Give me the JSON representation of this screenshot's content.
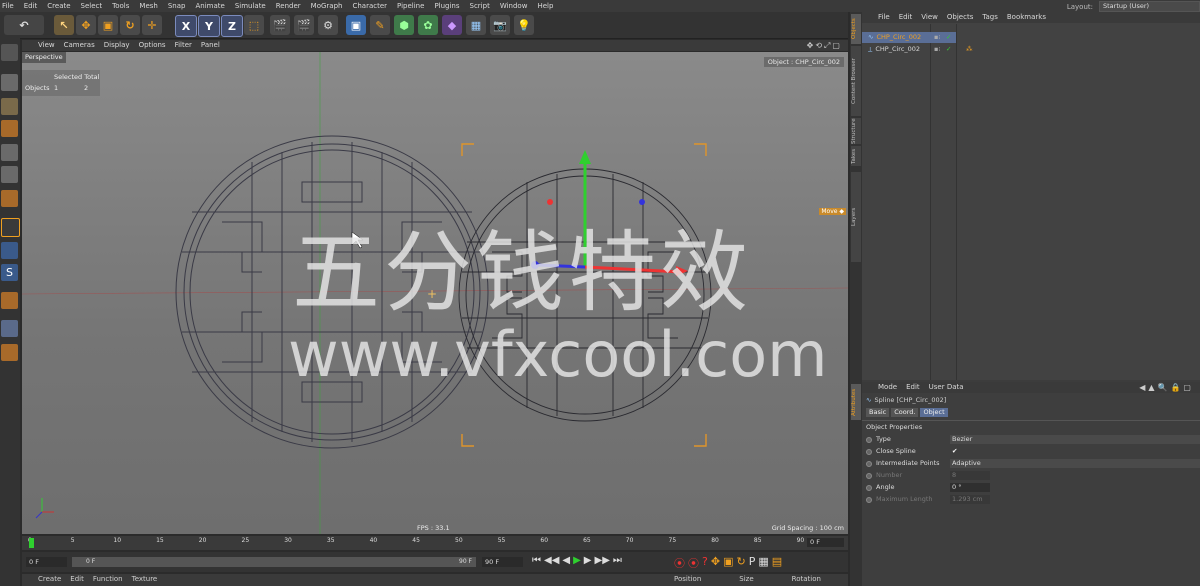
{
  "menubar": {
    "items": [
      "File",
      "Edit",
      "Create",
      "Select",
      "Tools",
      "Mesh",
      "Snap",
      "Animate",
      "Simulate",
      "Render",
      "MoGraph",
      "Character",
      "Pipeline",
      "Plugins",
      "Script",
      "Window",
      "Help"
    ],
    "layout_label": "Layout:",
    "layout_value": "Startup (User)"
  },
  "viewport_menu": {
    "items": [
      "View",
      "Cameras",
      "Display",
      "Options",
      "Filter",
      "Panel"
    ]
  },
  "viewport": {
    "label": "Perspective",
    "info_header": "Selected Total",
    "info_row_label": "Objects",
    "info_selected": "1",
    "info_total": "2",
    "title": "Object : CHP_Circ_002",
    "fps": "FPS : 33.1",
    "grid_spacing": "Grid Spacing : 100 cm",
    "move_tag": "Move ◆"
  },
  "watermark": {
    "line1": "五分钱特效",
    "line2": "www.vfxcool.com"
  },
  "timeline": {
    "ticks": [
      "0",
      "5",
      "10",
      "15",
      "20",
      "25",
      "30",
      "35",
      "40",
      "45",
      "50",
      "55",
      "60",
      "65",
      "70",
      "75",
      "80",
      "85",
      "90"
    ],
    "end_field": "0 F"
  },
  "transport": {
    "start": "0 F",
    "slider_start": "0 F",
    "slider_end": "90 F",
    "end": "90 F"
  },
  "bottom": {
    "left_items": [
      "Create",
      "Edit",
      "Function",
      "Texture"
    ],
    "right_items": [
      "Position",
      "Size",
      "Rotation"
    ]
  },
  "object_manager": {
    "menu": [
      "File",
      "Edit",
      "View",
      "Objects",
      "Tags",
      "Bookmarks"
    ],
    "objects": [
      {
        "name": "CHP_Circ_002",
        "selected": true
      },
      {
        "name": "CHP_Circ_002",
        "selected": false
      }
    ]
  },
  "side_tabs": [
    "Objects",
    "Content Browser",
    "Structure",
    "Takes",
    "Layers",
    "Attributes"
  ],
  "attributes": {
    "menu": [
      "Mode",
      "Edit",
      "User Data"
    ],
    "title": "Spline [CHP_Circ_002]",
    "tabs": [
      "Basic",
      "Coord.",
      "Object"
    ],
    "active_tab": "Object",
    "section": "Object Properties",
    "props": [
      {
        "label": "Type",
        "value": "Bezier",
        "kind": "dropdown"
      },
      {
        "label": "Close Spline",
        "value": "✔",
        "kind": "check"
      },
      {
        "label": "Intermediate Points",
        "value": "Adaptive",
        "kind": "dropdown"
      },
      {
        "label": "Number",
        "value": "8",
        "kind": "disabled"
      },
      {
        "label": "Angle",
        "value": "0 °",
        "kind": "field"
      },
      {
        "label": "Maximum Length",
        "value": "1.293 cm",
        "kind": "disabled"
      }
    ]
  },
  "colors": {
    "accent": "#f0a020",
    "selection": "#5a6e96",
    "viewport": "#7e7e7e"
  }
}
